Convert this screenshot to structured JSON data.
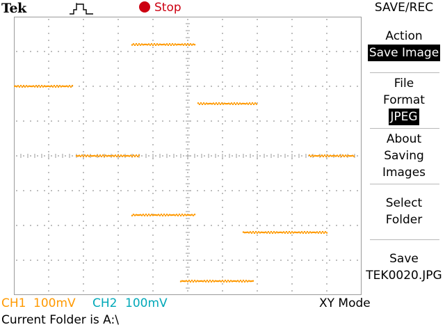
{
  "header": {
    "brand": "Tek",
    "trigger_icon": "pulse-trigger-icon",
    "status_icon": "record-dot-icon",
    "status": "Stop",
    "menu_title": "SAVE/REC"
  },
  "colors": {
    "trace": "#ff9900",
    "ch1": "#ff9900",
    "ch2": "#00a8b8",
    "stop": "#cc0011",
    "grid": "#9a9a9a"
  },
  "menu": {
    "action": {
      "label": "Action",
      "value": "Save Image"
    },
    "file_format": {
      "label_1": "File",
      "label_2": "Format",
      "value": "JPEG"
    },
    "about": {
      "line_1": "About",
      "line_2": "Saving",
      "line_3": "Images"
    },
    "select_folder": {
      "line_1": "Select",
      "line_2": "Folder"
    },
    "save": {
      "line_1": "Save",
      "line_2": "TEK0020.JPG"
    }
  },
  "readout": {
    "ch1_label": "CH1",
    "ch1_scale": "100mV",
    "ch2_label": "CH2",
    "ch2_scale": "100mV",
    "mode": "XY Mode",
    "folder_status": "Current Folder is A:\\"
  },
  "xy_trace": {
    "grid_divisions": {
      "x": 10,
      "y": 8
    },
    "segments": [
      {
        "x_start": -5.0,
        "x_end": -3.3,
        "y": 2.0
      },
      {
        "x_start": -3.2,
        "x_end": -1.4,
        "y": -0.0
      },
      {
        "x_start": -1.6,
        "x_end": 0.2,
        "y": -1.7
      },
      {
        "x_start": -0.2,
        "x_end": 1.9,
        "y": -3.6
      },
      {
        "x_start": 1.6,
        "x_end": 4.0,
        "y": -2.2
      },
      {
        "x_start": 3.5,
        "x_end": 4.8,
        "y": 0.0
      },
      {
        "x_start": 0.3,
        "x_end": 2.0,
        "y": 1.5
      },
      {
        "x_start": -1.6,
        "x_end": 0.2,
        "y": 3.2
      }
    ]
  }
}
